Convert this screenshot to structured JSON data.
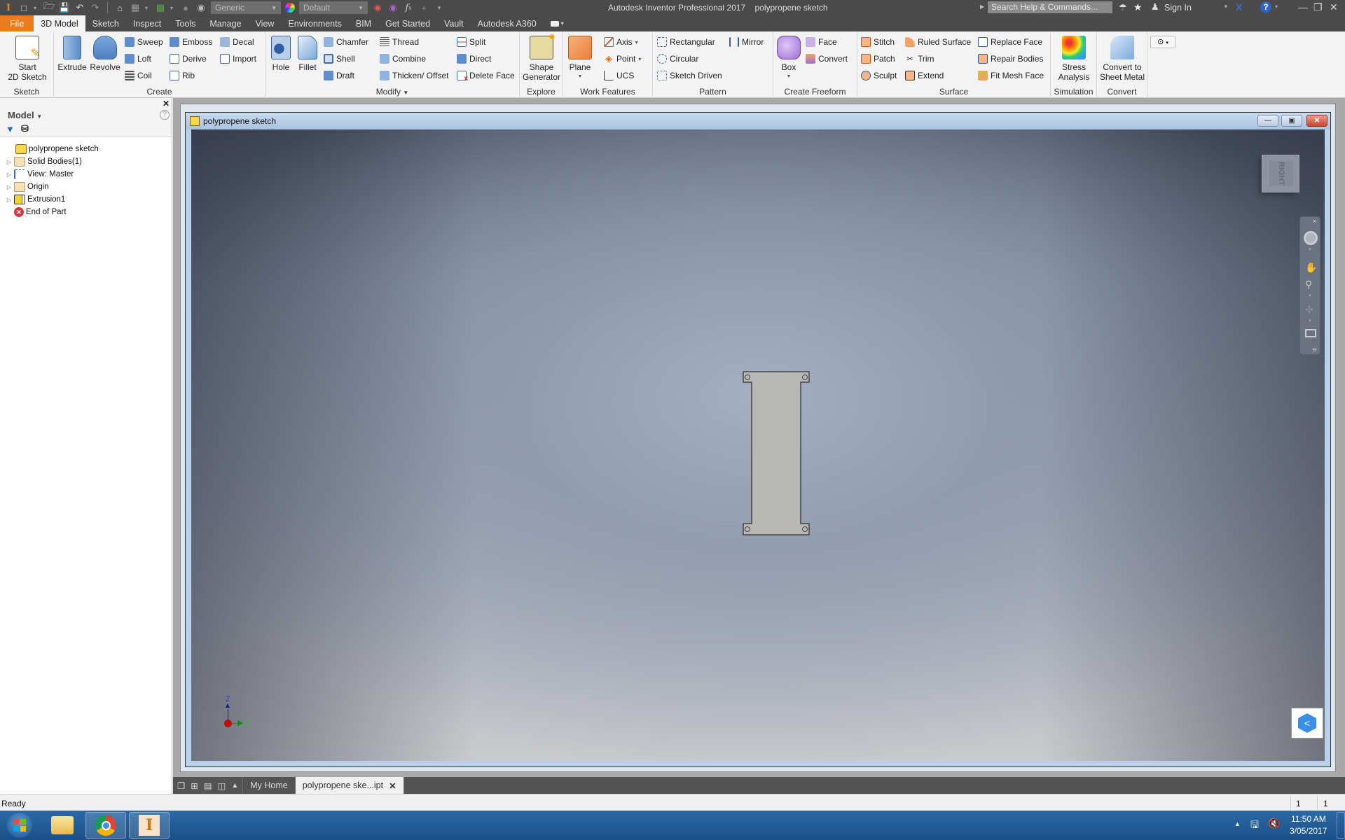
{
  "app": {
    "title": "Autodesk Inventor Professional 2017",
    "document_name": "polypropene sketch",
    "qat": {
      "material_select": "Generic",
      "appearance_select": "Default"
    },
    "search_placeholder": "Search Help & Commands...",
    "sign_in": "Sign In"
  },
  "menu_tabs": [
    {
      "label": "File"
    },
    {
      "label": "3D Model"
    },
    {
      "label": "Sketch"
    },
    {
      "label": "Inspect"
    },
    {
      "label": "Tools"
    },
    {
      "label": "Manage"
    },
    {
      "label": "View"
    },
    {
      "label": "Environments"
    },
    {
      "label": "BIM"
    },
    {
      "label": "Get Started"
    },
    {
      "label": "Vault"
    },
    {
      "label": "Autodesk A360"
    }
  ],
  "ribbon": {
    "sketch": {
      "title": "Sketch",
      "start_2d_sketch": "Start\n2D Sketch"
    },
    "create": {
      "title": "Create",
      "extrude": "Extrude",
      "revolve": "Revolve",
      "sweep": "Sweep",
      "loft": "Loft",
      "coil": "Coil",
      "emboss": "Emboss",
      "derive": "Derive",
      "rib": "Rib",
      "decal": "Decal",
      "import": "Import"
    },
    "modify": {
      "title": "Modify",
      "hole": "Hole",
      "fillet": "Fillet",
      "chamfer": "Chamfer",
      "shell": "Shell",
      "draft": "Draft",
      "thread": "Thread",
      "combine": "Combine",
      "thicken_offset": "Thicken/ Offset",
      "split": "Split",
      "direct": "Direct",
      "delete_face": "Delete Face"
    },
    "explore": {
      "title": "Explore",
      "shape_generator": "Shape\nGenerator"
    },
    "work_features": {
      "title": "Work Features",
      "plane": "Plane",
      "axis": "Axis",
      "point": "Point",
      "ucs": "UCS"
    },
    "pattern": {
      "title": "Pattern",
      "rectangular": "Rectangular",
      "circular": "Circular",
      "sketch_driven": "Sketch Driven",
      "mirror": "Mirror"
    },
    "create_freeform": {
      "title": "Create Freeform",
      "box": "Box",
      "face": "Face",
      "convert": "Convert"
    },
    "surface": {
      "title": "Surface",
      "stitch": "Stitch",
      "patch": "Patch",
      "sculpt": "Sculpt",
      "ruled_surface": "Ruled Surface",
      "trim": "Trim",
      "extend": "Extend",
      "replace_face": "Replace Face",
      "repair_bodies": "Repair Bodies",
      "fit_mesh_face": "Fit Mesh Face"
    },
    "simulation": {
      "title": "Simulation",
      "stress_analysis": "Stress\nAnalysis"
    },
    "convert": {
      "title": "Convert",
      "convert_to_sheet_metal": "Convert to\nSheet Metal"
    }
  },
  "browser": {
    "title": "Model",
    "items": [
      {
        "label": "polypropene sketch",
        "expandable": false
      },
      {
        "label": "Solid Bodies(1)",
        "expandable": true
      },
      {
        "label": "View: Master",
        "expandable": true
      },
      {
        "label": "Origin",
        "expandable": true
      },
      {
        "label": "Extrusion1",
        "expandable": true
      },
      {
        "label": "End of Part",
        "expandable": false
      }
    ]
  },
  "viewport": {
    "viewcube_label": "RIGHT",
    "triad": {
      "z": "Z",
      "y": "Y"
    }
  },
  "doc_tabs": [
    {
      "label": "My Home"
    },
    {
      "label": "polypropene ske...ipt"
    }
  ],
  "status": {
    "text": "Ready",
    "count1": "1",
    "count2": "1"
  },
  "taskbar": {
    "time": "11:50 AM",
    "date": "3/05/2017"
  }
}
